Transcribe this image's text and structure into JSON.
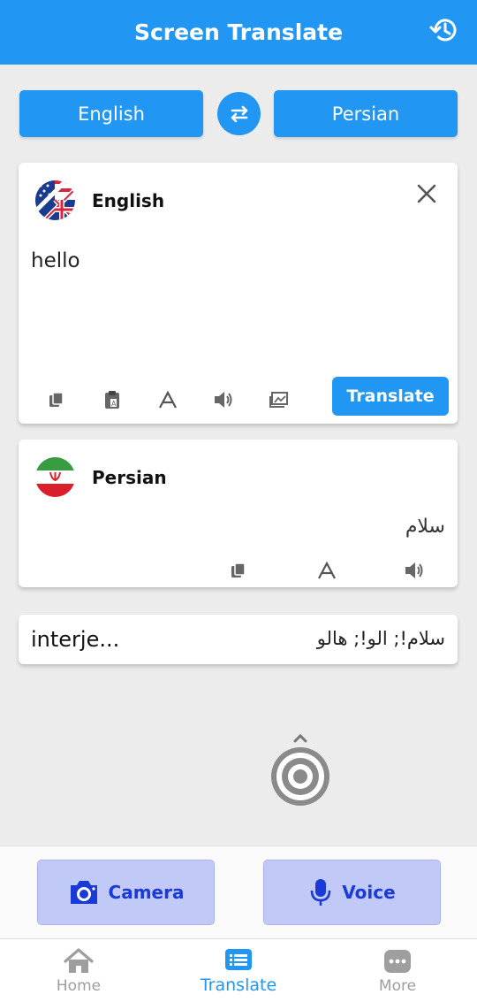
{
  "header": {
    "title": "Screen Translate",
    "history_icon": "history-icon"
  },
  "language_bar": {
    "source_language": "English",
    "target_language": "Persian",
    "swap_icon": "swap-icon"
  },
  "source_card": {
    "language": "English",
    "flag_icon": "uk-us-flag-icon",
    "text": "hello",
    "translate_label": "Translate",
    "tools": [
      "copy-icon",
      "paste-icon",
      "text-format-icon",
      "speaker-icon",
      "image-icon"
    ]
  },
  "result_card": {
    "language": "Persian",
    "flag_icon": "iran-flag-icon",
    "text": "سلام",
    "tools": [
      "copy-icon",
      "text-format-icon",
      "speaker-icon"
    ]
  },
  "dictionary": {
    "word": "interje...",
    "meaning": "سلام!; الو!; هالو"
  },
  "actions": {
    "camera_label": "Camera",
    "voice_label": "Voice"
  },
  "bottom_nav": {
    "items": [
      {
        "label": "Home",
        "icon": "home-icon"
      },
      {
        "label": "Translate",
        "icon": "translate-list-icon",
        "active": true
      },
      {
        "label": "More",
        "icon": "more-icon"
      }
    ]
  },
  "colors": {
    "primary": "#2196f3",
    "action_bg": "#c1c9f7",
    "action_text": "#1a3ad8"
  }
}
